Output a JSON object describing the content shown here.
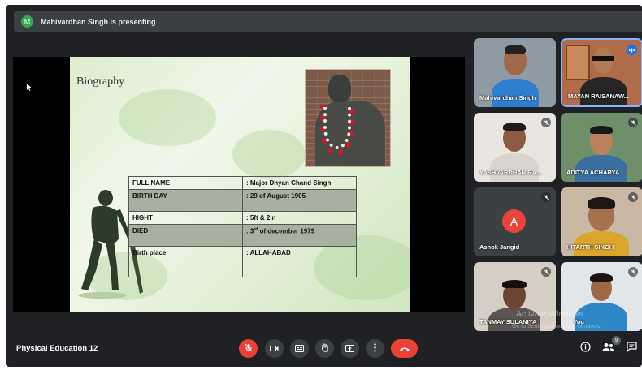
{
  "presenter_bar": {
    "avatar_letter": "M",
    "text": "Mahivardhan Singh is presenting"
  },
  "slide": {
    "title": "Biography",
    "table": [
      {
        "label": "FULL NAME",
        "value": ": Major Dhyan Chand Singh"
      },
      {
        "label": "BIRTH DAY",
        "value": ": 29 of August 1905"
      },
      {
        "label": "HIGHT",
        "value": ": 5ft & 2in"
      },
      {
        "label": "DIED",
        "value_pre": ": 3",
        "value_sup": "rd",
        "value_post": " of december  1979"
      },
      {
        "label": "Birth place",
        "value": ": ALLAHABAD"
      }
    ]
  },
  "participants": [
    {
      "name": "Mahivardhan Singh",
      "state": "presenting"
    },
    {
      "name": "MAYAN RAISANAW...",
      "state": "speaking"
    },
    {
      "name": "YASHVARDHAN RA...",
      "state": "muted"
    },
    {
      "name": "ADITYA ACHARYA",
      "state": "muted"
    },
    {
      "name": "Ashok Jangid",
      "avatar_letter": "A",
      "state": "muted"
    },
    {
      "name": "HITARTH SINGH",
      "state": "muted"
    },
    {
      "name": "TANMAY SULANIYA",
      "state": "muted"
    },
    {
      "name": "You",
      "state": "muted"
    }
  ],
  "watermark": {
    "line1": "Activate Windows",
    "line2": "Go to Settings to activate Windows."
  },
  "bottom_bar": {
    "meeting_title": "Physical Education 12",
    "people_count": "9"
  },
  "colors": {
    "background": "#202124",
    "tile": "#3c4043",
    "danger": "#ea4335",
    "speaking": "#1a73e8"
  }
}
